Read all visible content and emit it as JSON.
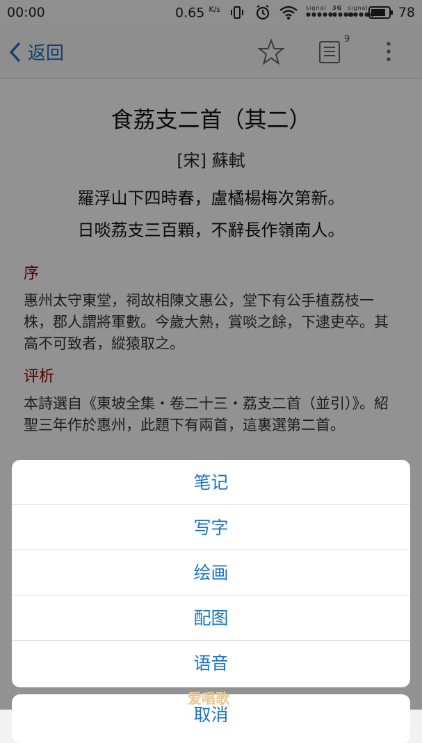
{
  "status_bar": {
    "time": "00:00",
    "speed_value": "0.65",
    "speed_unit": "K/s",
    "signal_label": "signal",
    "network": "3G",
    "battery": "78"
  },
  "nav": {
    "back_label": "返回",
    "list_badge": "9"
  },
  "poem": {
    "title": "食荔支二首（其二）",
    "author": "[宋] 蘇軾",
    "lines": [
      "羅浮山下四時春，盧橘楊梅次第新。",
      "日啖荔支三百顆，不辭長作嶺南人。"
    ]
  },
  "preface": {
    "heading": "序",
    "text": "惠州太守東堂，祠故相陳文惠公，堂下有公手植荔枝一株，郡人謂將軍數。今歲大熟，賞啖之餘，下逮吏卒。其高不可致者，縱猿取之。"
  },
  "commentary": {
    "heading": "评析",
    "text": "本詩選自《東坡全集・卷二十三・荔支二首（並引）》。紹聖三年作於惠州，此題下有兩首，這裏選第二首。"
  },
  "action_sheet": {
    "items": [
      "笔记",
      "写字",
      "绘画",
      "配图",
      "语音"
    ],
    "cancel": "取消"
  },
  "watermark": "爱唱歌"
}
